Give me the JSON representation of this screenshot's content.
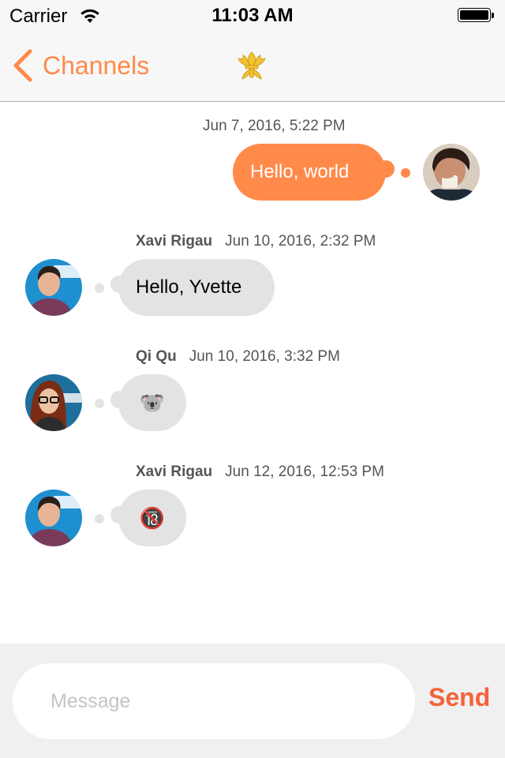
{
  "status_bar": {
    "carrier": "Carrier",
    "time": "11:03 AM",
    "wifi_icon": "wifi-icon",
    "battery_icon": "battery-full-icon"
  },
  "nav": {
    "back_label": "Channels",
    "back_icon": "chevron-left-icon",
    "logo_icon": "fleur-de-lis-icon",
    "accent_color": "#ff8a4a"
  },
  "messages": [
    {
      "direction": "outgoing",
      "sender": "",
      "timestamp": "Jun 7, 2016, 5:22 PM",
      "text": "Hello, world",
      "bubble_color": "#ff8a4a"
    },
    {
      "direction": "incoming",
      "sender": "Xavi Rigau",
      "timestamp": "Jun 10, 2016, 2:32 PM",
      "text": "Hello, Yvette",
      "bubble_color": "#e3e3e3"
    },
    {
      "direction": "incoming",
      "sender": "Qi Qu",
      "timestamp": "Jun 10, 2016, 3:32 PM",
      "text": "🐨",
      "emoji_name": "koala-emoji"
    },
    {
      "direction": "incoming",
      "sender": "Xavi Rigau",
      "timestamp": "Jun 12, 2016, 12:53 PM",
      "text": "🔞",
      "emoji_name": "no-one-under-eighteen-emoji"
    }
  ],
  "composer": {
    "placeholder": "Message",
    "value": "",
    "send_label": "Send",
    "send_color": "#f4623a"
  }
}
